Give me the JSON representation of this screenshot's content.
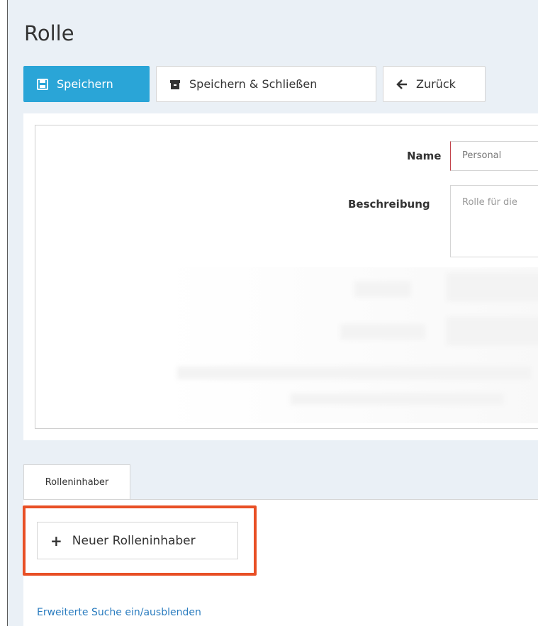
{
  "header": {
    "title": "Rolle"
  },
  "toolbar": {
    "save_label": "Speichern",
    "save_close_label": "Speichern & Schließen",
    "back_label": "Zurück"
  },
  "form": {
    "name_label": "Name",
    "name_value": "Personal",
    "description_label": "Beschreibung",
    "description_value": "Rolle für die"
  },
  "tabs": [
    {
      "label": "Rolleninhaber"
    }
  ],
  "role_holders": {
    "new_button_label": "Neuer Rolleninhaber",
    "advanced_search_link": "Erweiterte Suche ein/ausblenden"
  },
  "colors": {
    "primary": "#2aa5d7",
    "highlight": "#e84f25",
    "link": "#2a7cbf",
    "required_marker": "#c3434b"
  },
  "icons": [
    "save-icon",
    "archive-icon",
    "arrow-left-icon",
    "plus-icon"
  ]
}
